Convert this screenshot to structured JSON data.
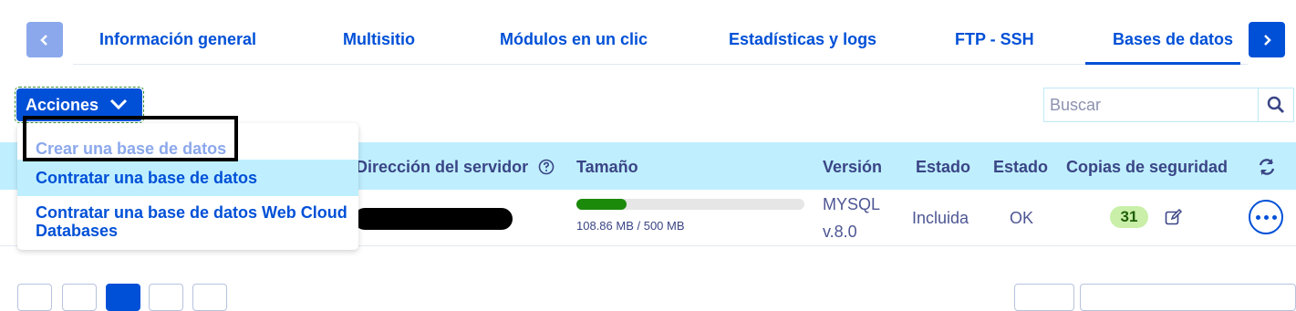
{
  "tabs": {
    "prev_icon": "chevron-left-icon",
    "next_icon": "chevron-right-icon",
    "items": [
      {
        "label": "Información general"
      },
      {
        "label": "Multisitio"
      },
      {
        "label": "Módulos en un clic"
      },
      {
        "label": "Estadísticas y logs"
      },
      {
        "label": "FTP - SSH"
      },
      {
        "label": "Bases de datos",
        "active": true
      }
    ]
  },
  "toolbar": {
    "actions_label": "Acciones",
    "search_placeholder": "Buscar"
  },
  "actions_menu": {
    "items": [
      {
        "label": "Crear una base de datos",
        "disabled": true
      },
      {
        "label": "Contratar una base de datos",
        "hovered": true
      },
      {
        "label": "Contratar una base de datos Web Cloud Databases"
      }
    ]
  },
  "table": {
    "columns": [
      "Dirección del servidor",
      "Tamaño",
      "Versión",
      "Estado",
      "Estado",
      "Copias de seguridad"
    ],
    "rows": [
      {
        "server": "[redacted]",
        "size_text": "108.86 MB / 500 MB",
        "size_fraction": 0.218,
        "version_line1": "MYSQL",
        "version_line2": "v.8.0",
        "status1": "Incluida",
        "status2": "OK",
        "backups": "31"
      }
    ]
  },
  "colors": {
    "primary": "#0050d7",
    "header_bg": "#bfefff",
    "progress": "#1b8a0a"
  }
}
